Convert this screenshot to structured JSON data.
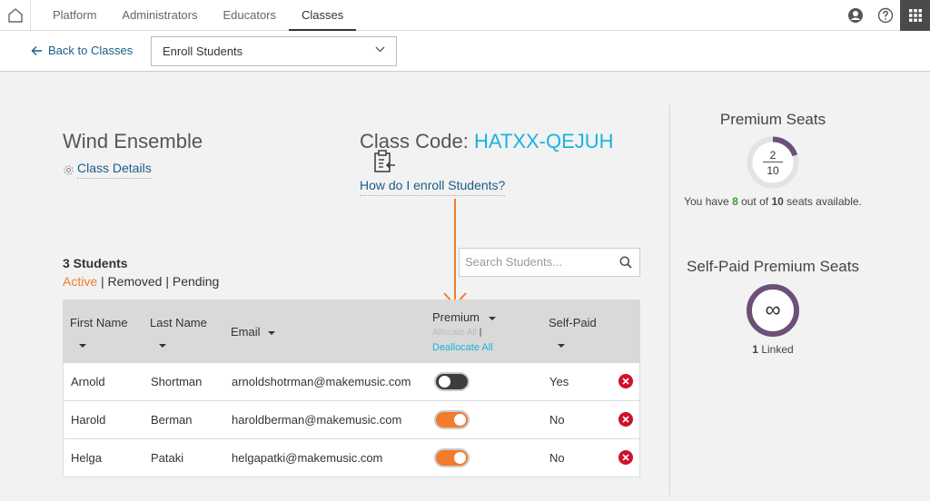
{
  "nav": {
    "tabs": [
      {
        "label": "Platform"
      },
      {
        "label": "Administrators"
      },
      {
        "label": "Educators"
      },
      {
        "label": "Classes"
      }
    ],
    "active_tab": "Classes",
    "icons": [
      "home-icon",
      "account-icon",
      "help-icon",
      "apps-grid-icon"
    ]
  },
  "subbar": {
    "back_label": "Back to Classes",
    "select_value": "Enroll Students"
  },
  "class": {
    "name": "Wind Ensemble",
    "details_link": "Class Details",
    "code_label": "Class Code: ",
    "code_value": "HATXX-QEJUH",
    "howto_link": "How do I enroll Students?"
  },
  "students": {
    "count_label": "3 Students",
    "filters": [
      {
        "label": "Active"
      },
      {
        "label": "Removed"
      },
      {
        "label": "Pending"
      }
    ],
    "filter_sep": "|",
    "search_placeholder": "Search Students..."
  },
  "table": {
    "headers": {
      "first_name": "First Name",
      "last_name": "Last Name",
      "email": "Email",
      "premium": "Premium",
      "self_paid": "Self-Paid",
      "allocate_all": "Allocate All",
      "alloc_sep": "|",
      "deallocate_all": "Deallocate All"
    },
    "rows": [
      {
        "first": "Arnold",
        "last": "Shortman",
        "email": "arnoldshotrman@makemusic.com",
        "premium_on": false,
        "self_paid": "Yes"
      },
      {
        "first": "Harold",
        "last": "Berman",
        "email": "haroldberman@makemusic.com",
        "premium_on": true,
        "self_paid": "No"
      },
      {
        "first": "Helga",
        "last": "Pataki",
        "email": "helgapatki@makemusic.com",
        "premium_on": true,
        "self_paid": "No"
      }
    ]
  },
  "premium_seats": {
    "title": "Premium Seats",
    "used": "2",
    "total": "10",
    "used_fraction": 0.2,
    "avail_prefix": "You have ",
    "avail_count": "8",
    "avail_mid": " out of ",
    "avail_total": "10",
    "avail_suffix": " seats available."
  },
  "self_paid_seats": {
    "title": "Self-Paid Premium Seats",
    "symbol": "∞",
    "linked_count": "1",
    "linked_label": " Linked"
  },
  "colors": {
    "accent_orange": "#f07c2c",
    "link_blue": "#1a5d8a",
    "code_cyan": "#1ab3dd",
    "donut_purple": "#6b5078",
    "remove_red": "#d0112b",
    "toggle_off": "#3d3d3d"
  }
}
